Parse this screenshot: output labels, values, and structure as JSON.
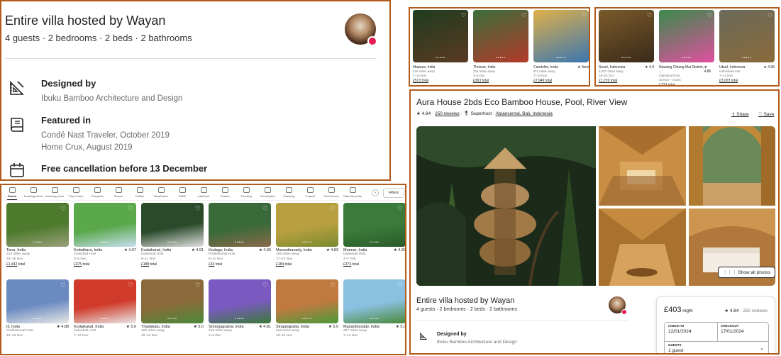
{
  "panel_a": {
    "title": "Entire villa hosted by Wayan",
    "subtitle": "4 guests · 2 bedrooms · 2 beds · 2 bathrooms",
    "features": [
      {
        "icon": "designer-icon",
        "title": "Designed by",
        "lines": [
          "Ibuku Bamboo Architecture and Design"
        ]
      },
      {
        "icon": "book-icon",
        "title": "Featured in",
        "lines": [
          "Condé Nast Traveler, October 2019",
          "Home Crux, August 2019"
        ]
      },
      {
        "icon": "calendar-icon",
        "title": "Free cancellation before 13 December",
        "lines": []
      }
    ]
  },
  "panel_b": {
    "listings": [
      {
        "place": "Mapusa, India",
        "rating": "",
        "dist": "218 miles away",
        "dates": "7–12 Nov",
        "price": "£513 total",
        "colors": [
          "#1f3c1f",
          "#5a3a22"
        ]
      },
      {
        "place": "Thrissur, India",
        "rating": "",
        "dist": "332 miles away",
        "dates": "3–8 Dec",
        "price": "£263 total",
        "colors": [
          "#3a6e3a",
          "#b33a2a"
        ]
      },
      {
        "place": "Candolim, India",
        "rating": "★ New",
        "dist": "411 miles away",
        "dates": "7–12 Nov",
        "price": "£2,949 total",
        "colors": [
          "#e0b04a",
          "#3a76b0"
        ]
      }
    ]
  },
  "panel_c": {
    "listings": [
      {
        "place": "Seset, Indonesia",
        "rating": "★ 4.9",
        "dist": "2,037 miles away",
        "dates": "18–23 Oct",
        "price": "£1,276 total",
        "colors": [
          "#7a5a2a",
          "#3a2a1a"
        ]
      },
      {
        "place": "Nawang Chiang Mai District, ...",
        "rating": "★ 4.86",
        "dist": "Individual Host",
        "dates": "30 Nov – 5 Dec",
        "price": "£133 total",
        "colors": [
          "#3a8a4a",
          "#e050a0"
        ]
      },
      {
        "place": "Ubud, Indonesia",
        "rating": "★ 4.96",
        "dist": "Individual Host",
        "dates": "7–12 Nov",
        "price": "£3,023 total",
        "colors": [
          "#6a6a5a",
          "#8a6a3a"
        ]
      }
    ]
  },
  "panel_d": {
    "categories": [
      "Farms",
      "Amazing views",
      "Amazing pools",
      "Tiny homes",
      "Vineyards",
      "Rooms",
      "Cabins",
      "Beachfront",
      "OMG!",
      "Lakefront",
      "Castles",
      "Trending",
      "Countryside",
      "Camping",
      "Tropical",
      "Treehouses",
      "National parks"
    ],
    "filters_label": "Filters",
    "listings": [
      {
        "place": "Tarur, India",
        "rating": "",
        "l2": "210 miles away",
        "l3": "10–15 Nov",
        "price": "£1,442",
        "colors": [
          "#4e7a2e",
          "#9aa07a"
        ]
      },
      {
        "place": "Kottathara, India",
        "rating": "★ 4.97",
        "l2": "Individual Host",
        "l3": "3–8 Dec",
        "price": "£375",
        "colors": [
          "#5aa84a",
          "#c8e0f0"
        ]
      },
      {
        "place": "Kodaikanal, India",
        "rating": "★ 4.91",
        "l2": "Individual Host",
        "l3": "6–11 Nov",
        "price": "£188",
        "colors": [
          "#2a4a2a",
          "#e0e0e0"
        ]
      },
      {
        "place": "Kodagu, India",
        "rating": "★ 4.93",
        "l2": "Professional Host",
        "l3": "6–11 Nov",
        "price": "£63",
        "colors": [
          "#3a6a3a",
          "#8a6a4a"
        ]
      },
      {
        "place": "Mananthavady, India",
        "rating": "★ 4.83",
        "l2": "299 miles away",
        "l3": "17–22 Nov",
        "price": "£184",
        "colors": [
          "#b8a040",
          "#7a8a30"
        ]
      },
      {
        "place": "Munnar, India",
        "rating": "★ 4.83",
        "l2": "Individual Host",
        "l3": "2–7 Feb",
        "price": "£373",
        "colors": [
          "#3a7a3a",
          "#2a5a2a"
        ]
      },
      {
        "place": "Ili, India",
        "rating": "★ 4.88",
        "l2": "Professional Host",
        "l3": "18–23 Nov",
        "price": "",
        "colors": [
          "#6a8ac0",
          "#e8e8e8"
        ]
      },
      {
        "place": "Kodaikanal, India",
        "rating": "★ 5.0",
        "l2": "Individual Host",
        "l3": "7–12 Nov",
        "price": "",
        "colors": [
          "#d03a2a",
          "#e8e8e8"
        ]
      },
      {
        "place": "Thadakalu, India",
        "rating": "★ 5.0",
        "l2": "300 miles away",
        "l3": "19–24 Nov",
        "price": "",
        "colors": [
          "#8a6a3a",
          "#4a8a3a"
        ]
      },
      {
        "place": "Srirangapatna, India",
        "rating": "★ 4.81",
        "l2": "216 miles away",
        "l3": "3–8 Dec",
        "price": "",
        "colors": [
          "#7a5ac0",
          "#3a7a3a"
        ]
      },
      {
        "place": "Singanapalia, India",
        "rating": "★ 5.0",
        "l2": "216 miles away",
        "l3": "19–24 Nov",
        "price": "",
        "colors": [
          "#c07a40",
          "#4a9a3a"
        ]
      },
      {
        "place": "Mananthavady, India",
        "rating": "★ 5.0",
        "l2": "297 miles away",
        "l3": "7–12 Nov",
        "price": "",
        "colors": [
          "#8ac0e0",
          "#4a8a3a"
        ]
      }
    ],
    "total_suffix": "total"
  },
  "panel_e": {
    "title": "Aura House 2bds Eco Bamboo House, Pool, River View",
    "rating": "★ 4.84 ·",
    "reviews": "250 reviews",
    "superhost": "· 🎖 Superhost ·",
    "location": "Abiansemal, Bali, Indonesia",
    "share": "⇧ Share",
    "save": "♡ Save",
    "show_all": "Show all photos",
    "listing_title": "Entire villa hosted by Wayan",
    "listing_sub": "4 guests · 2 bedrooms · 2 beds · 2 bathrooms",
    "designed_title": "Designed by",
    "designed_sub": "Ibuku Bamboo Architecture and Design",
    "booking": {
      "price": "£403",
      "per": " night",
      "rating": "★ 4.84 ·",
      "reviews": " 250 reviews",
      "checkin_label": "CHECK-IN",
      "checkin_value": "12/01/2024",
      "checkout_label": "CHECKOUT",
      "checkout_value": "17/01/2024",
      "guests_label": "GUESTS",
      "guests_value": "1 guest"
    }
  }
}
